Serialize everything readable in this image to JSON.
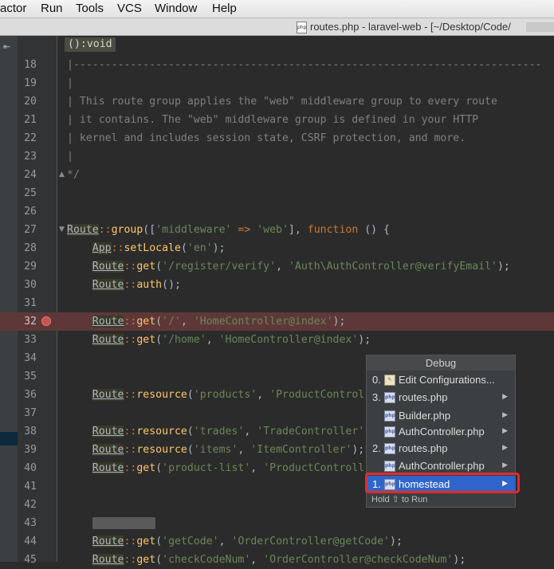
{
  "menubar": {
    "items": [
      "actor",
      "Run",
      "Tools",
      "VCS",
      "Window",
      "Help"
    ]
  },
  "titlebar": {
    "file_icon": "php-file-icon",
    "text": "routes.php - laravel-web - [~/Desktop/Code/"
  },
  "sidebar": {
    "icon": "collapse-icon",
    "icon_glyph": "⇤"
  },
  "editor": {
    "inlay_hint": "():void",
    "lines": [
      {
        "n": "18"
      },
      {
        "n": "19"
      },
      {
        "n": "20"
      },
      {
        "n": "21"
      },
      {
        "n": "22"
      },
      {
        "n": "23"
      },
      {
        "n": "24"
      },
      {
        "n": "25"
      },
      {
        "n": "26"
      },
      {
        "n": "27"
      },
      {
        "n": "28"
      },
      {
        "n": "29"
      },
      {
        "n": "30"
      },
      {
        "n": "31"
      },
      {
        "n": "32"
      },
      {
        "n": "33"
      },
      {
        "n": "34"
      },
      {
        "n": "35"
      },
      {
        "n": "36"
      },
      {
        "n": "37"
      },
      {
        "n": "38"
      },
      {
        "n": "39"
      },
      {
        "n": "40"
      },
      {
        "n": "41"
      },
      {
        "n": "42"
      },
      {
        "n": "43"
      },
      {
        "n": "44"
      },
      {
        "n": "45"
      }
    ],
    "code": {
      "l18": "|--------------------------------------------------------------------------",
      "l19": "|",
      "l20": "| This route group applies the \"web\" middleware group to every route",
      "l21": "| it contains. The \"web\" middleware group is defined in your HTTP",
      "l22": "| kernel and includes session state, CSRF protection, and more.",
      "l23": "|",
      "l24": "*/",
      "route": "Route",
      "app": "App",
      "sep": "::",
      "group": "group",
      "middleware_key": "'middleware'",
      "arrow": " => ",
      "web": "'web'",
      "function_kw": "function",
      "open_fn": " () {",
      "setLocale": "setLocale",
      "en": "'en'",
      "get": "get",
      "auth": "auth",
      "resource": "resource",
      "register_verify": "'/register/verify'",
      "auth_verify": "'Auth\\AuthController@verifyEmail'",
      "root": "'/'",
      "home_index": "'HomeController@index'",
      "home": "'/home'",
      "products": "'products'",
      "product_controller": "'ProductControl",
      "trades": "'trades'",
      "trade_controller": "'TradeController'",
      "items": "'items'",
      "item_controller": "'ItemController'",
      "product_list": "'product-list'",
      "product_controll": "'ProductControll",
      "getcode": "'getCode'",
      "order_getcode": "'OrderController@getCode'",
      "check_code_num": "'checkCodeNum'",
      "order_check": "'OrderController@checkCodeNum'",
      "blurred_43": "middleware"
    }
  },
  "debug_popup": {
    "title": "Debug",
    "items": [
      {
        "num": "0.",
        "label": "Edit Configurations...",
        "icon": "edit-config-icon"
      },
      {
        "num": "3.",
        "label": "routes.php",
        "icon": "php-file-icon",
        "submenu": true
      },
      {
        "num": "",
        "label": "Builder.php",
        "icon": "php-file-icon",
        "submenu": true
      },
      {
        "num": "",
        "label": "AuthController.php",
        "icon": "php-file-icon",
        "submenu": true
      },
      {
        "num": "2.",
        "label": "routes.php",
        "icon": "php-file-icon",
        "submenu": true
      },
      {
        "num": "",
        "label": "AuthController.php",
        "icon": "php-file-icon",
        "submenu": true
      },
      {
        "num": "1.",
        "label": "homestead",
        "icon": "php-file-icon",
        "submenu": true,
        "selected": true
      }
    ],
    "footer": "Hold ⇧ to Run",
    "icon_text": "php",
    "arrow": "▶"
  },
  "colors": {
    "editor_bg": "#2b2b2b",
    "breakpoint": "#c75450",
    "breakpoint_line": "#5e3838",
    "selection": "#2f65ca",
    "highlight_box": "#e22b2b"
  }
}
